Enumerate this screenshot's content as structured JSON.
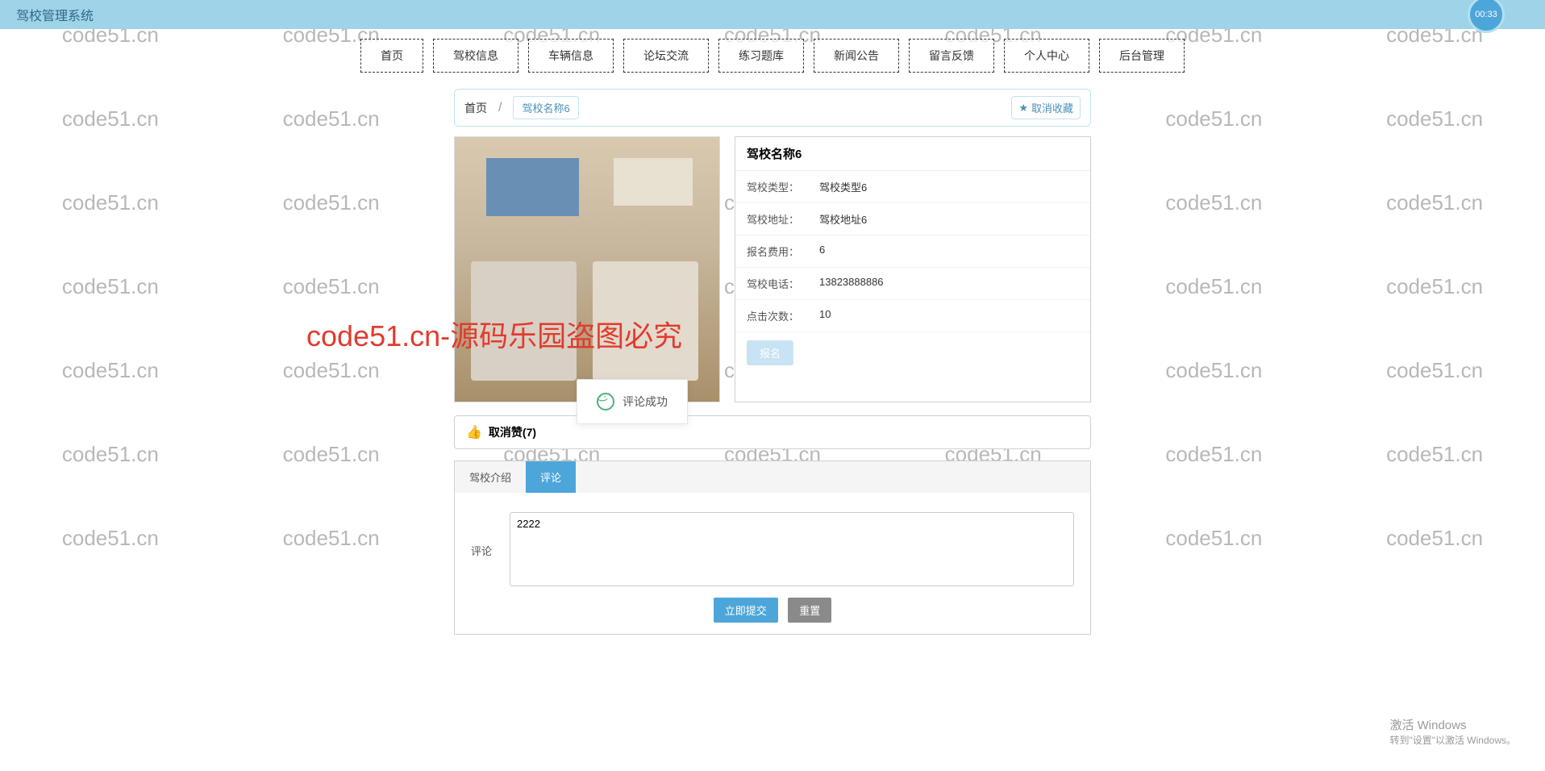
{
  "header": {
    "title": "驾校管理系统",
    "clock": "00:33"
  },
  "nav": [
    "首页",
    "驾校信息",
    "车辆信息",
    "论坛交流",
    "练习题库",
    "新闻公告",
    "留言反馈",
    "个人中心",
    "后台管理"
  ],
  "breadcrumb": {
    "home": "首页",
    "sep": "/",
    "current": "驾校名称6",
    "collect": "取消收藏"
  },
  "info": {
    "title": "驾校名称6",
    "rows": [
      {
        "label": "驾校类型：",
        "value": "驾校类型6"
      },
      {
        "label": "驾校地址：",
        "value": "驾校地址6"
      },
      {
        "label": "报名费用：",
        "value": "6"
      },
      {
        "label": "驾校电话：",
        "value": "13823888886"
      },
      {
        "label": "点击次数：",
        "value": "10"
      }
    ],
    "signup": "报名"
  },
  "big_mark": "code51.cn-源码乐园盗图必究",
  "toast": "评论成功",
  "like": {
    "text": "取消赞(7)"
  },
  "tabs": {
    "intro": "驾校介绍",
    "comment": "评论"
  },
  "form": {
    "label": "评论",
    "value": "2222",
    "submit": "立即提交",
    "reset": "重置"
  },
  "watermark_text": "code51.cn",
  "win": {
    "title": "激活 Windows",
    "sub": "转到\"设置\"以激活 Windows。"
  }
}
